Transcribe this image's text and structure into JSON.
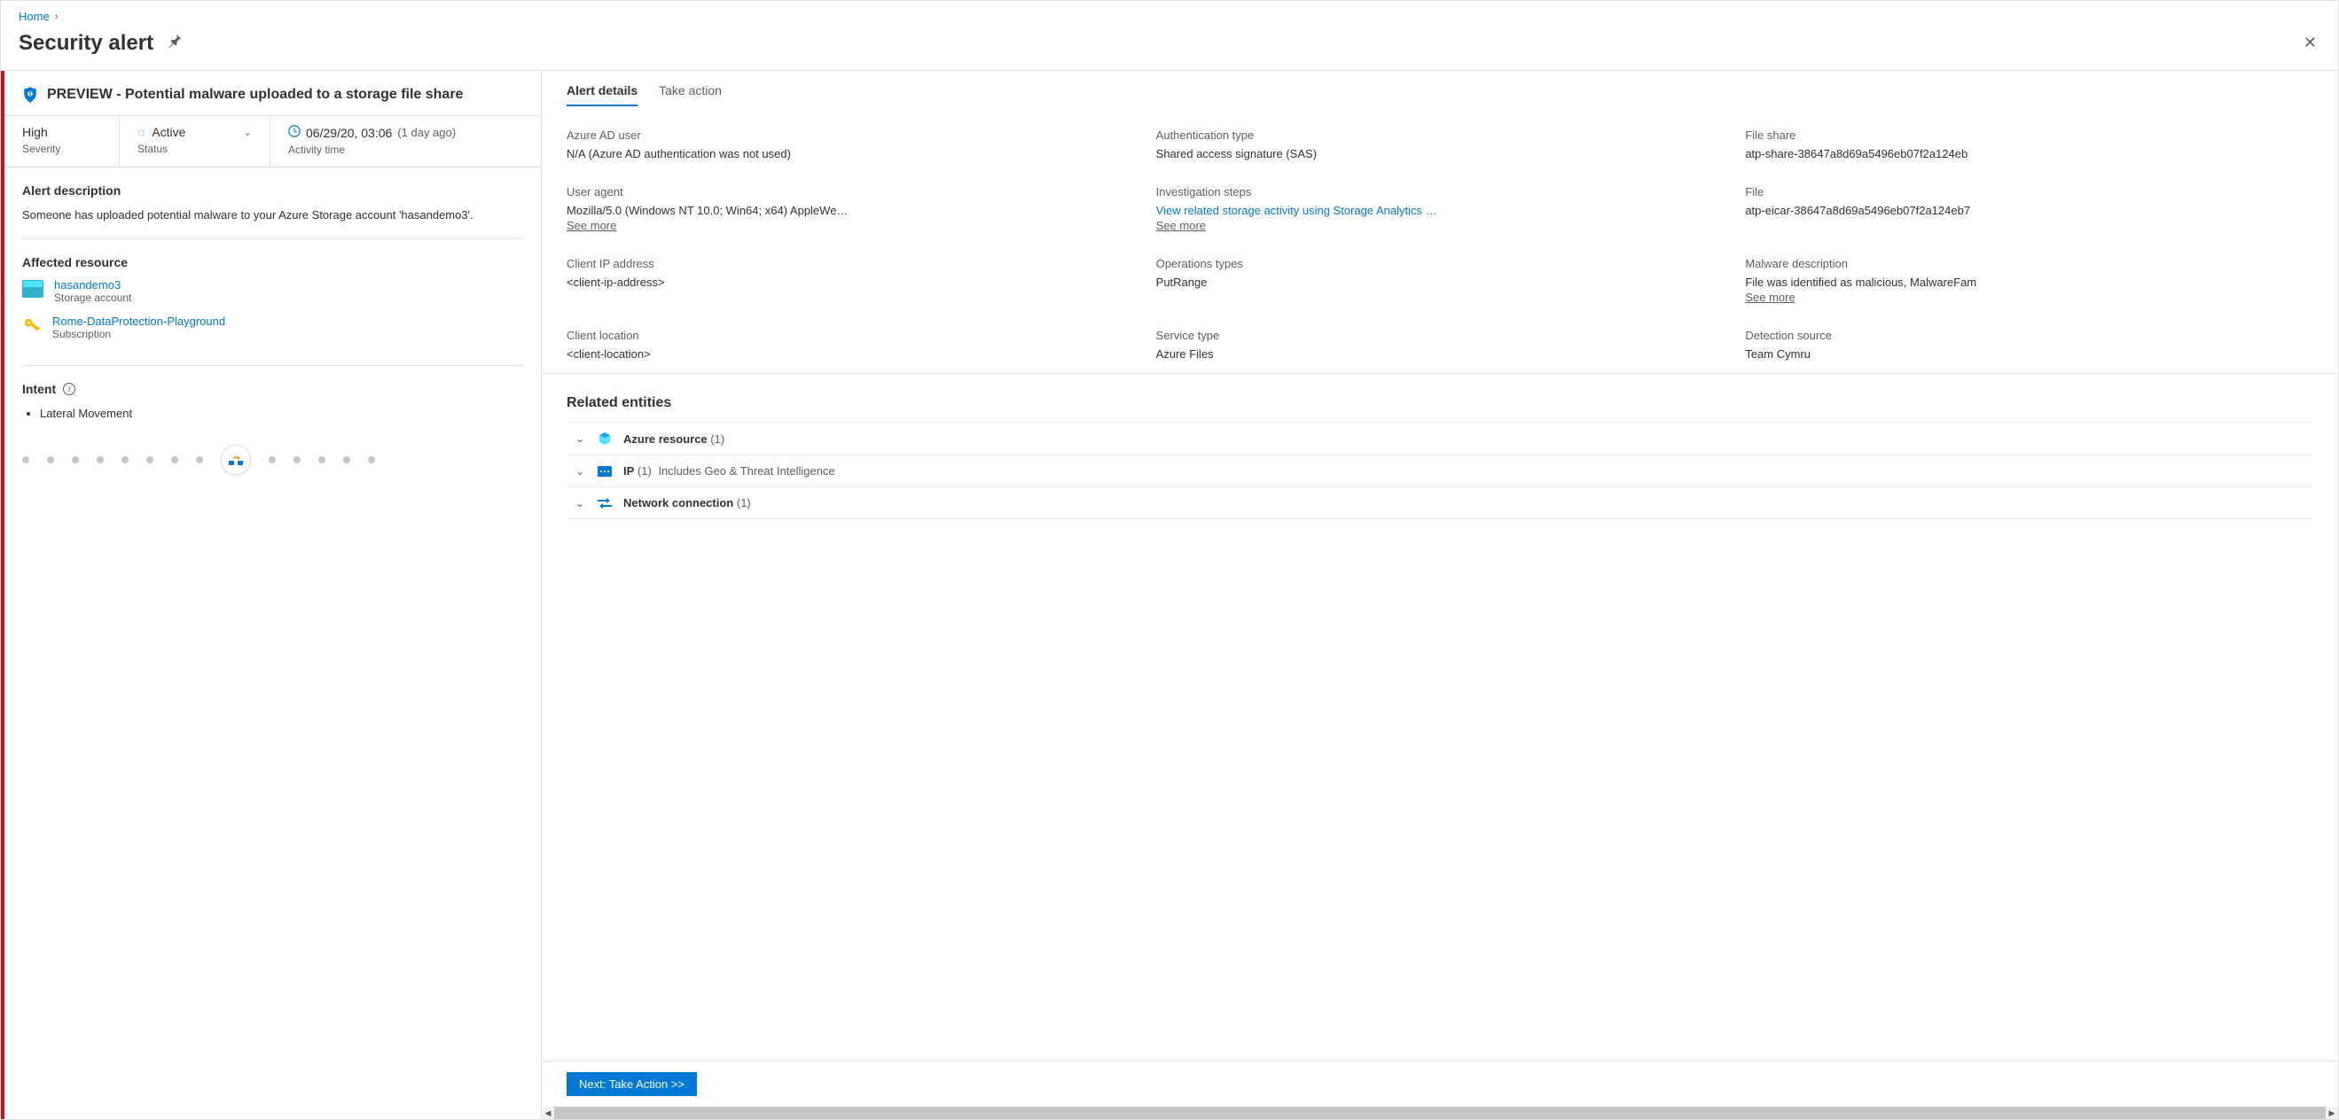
{
  "breadcrumb": {
    "home": "Home"
  },
  "header": {
    "title": "Security alert"
  },
  "alert": {
    "title": "PREVIEW - Potential malware uploaded to a storage file share",
    "severity_value": "High",
    "severity_label": "Severity",
    "status_value": "Active",
    "status_label": "Status",
    "time_value": "06/29/20, 03:06",
    "time_ago": "(1 day ago)",
    "time_label": "Activity time"
  },
  "description": {
    "title": "Alert description",
    "text": "Someone has uploaded potential malware to your Azure Storage account 'hasandemo3'."
  },
  "affected": {
    "title": "Affected resource",
    "resource_name": "hasandemo3",
    "resource_type": "Storage account",
    "sub_name": "Rome-DataProtection-Playground",
    "sub_type": "Subscription"
  },
  "intent": {
    "title": "Intent",
    "items": [
      "Lateral Movement"
    ]
  },
  "tabs": {
    "details": "Alert details",
    "action": "Take action"
  },
  "details": {
    "azure_ad_user": {
      "label": "Azure AD user",
      "value": "N/A (Azure AD authentication was not used)"
    },
    "auth_type": {
      "label": "Authentication type",
      "value": "Shared access signature (SAS)"
    },
    "file_share": {
      "label": "File share",
      "value": "atp-share-38647a8d69a5496eb07f2a124eb"
    },
    "user_agent": {
      "label": "User agent",
      "value": "Mozilla/5.0 (Windows NT 10.0; Win64; x64) AppleWe…",
      "see_more": "See more"
    },
    "investigation": {
      "label": "Investigation steps",
      "link": "View related storage activity using Storage Analytics …",
      "see_more": "See more"
    },
    "file": {
      "label": "File",
      "value": "atp-eicar-38647a8d69a5496eb07f2a124eb7"
    },
    "client_ip": {
      "label": "Client IP address",
      "value": "<client-ip-address>"
    },
    "operations": {
      "label": "Operations types",
      "value": "PutRange"
    },
    "malware": {
      "label": "Malware description",
      "value": "File was identified as malicious, MalwareFam",
      "see_more": "See more"
    },
    "client_loc": {
      "label": "Client location",
      "value": "<client-location>"
    },
    "service_type": {
      "label": "Service type",
      "value": "Azure Files"
    },
    "detection": {
      "label": "Detection source",
      "value": "Team Cymru"
    }
  },
  "entities": {
    "title": "Related entities",
    "azure_resource": {
      "name": "Azure resource",
      "count": "(1)"
    },
    "ip": {
      "name": "IP",
      "count": "(1)",
      "sub": "Includes Geo & Threat Intelligence"
    },
    "network": {
      "name": "Network connection",
      "count": "(1)"
    }
  },
  "next_button": "Next: Take Action >>"
}
